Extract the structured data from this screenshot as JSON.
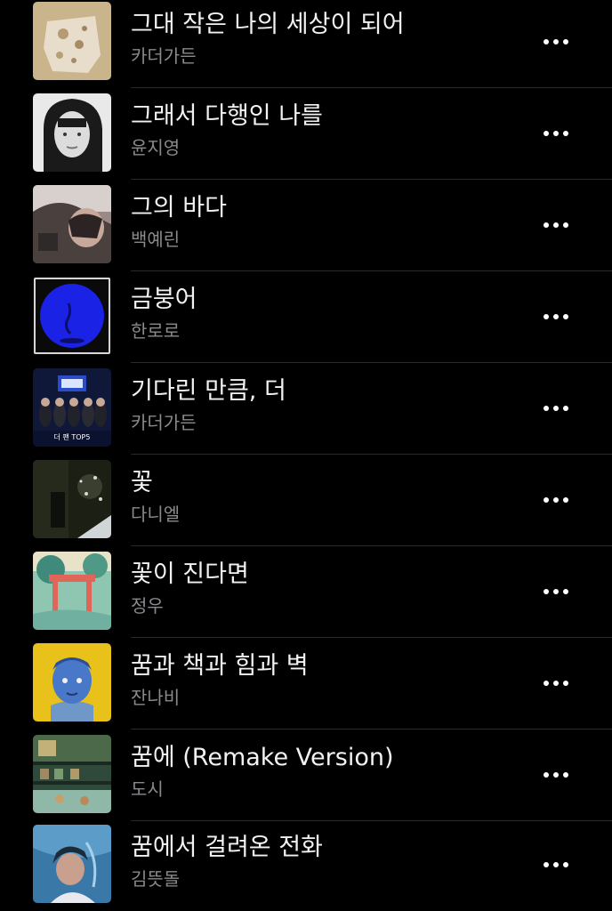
{
  "songs": [
    {
      "title": "그대 작은 나의 세상이 되어",
      "artist": "카더가든"
    },
    {
      "title": "그래서 다행인 나를",
      "artist": "윤지영"
    },
    {
      "title": "그의 바다",
      "artist": "백예린"
    },
    {
      "title": "금붕어",
      "artist": "한로로"
    },
    {
      "title": "기다린 만큼, 더",
      "artist": "카더가든",
      "art_text": "더 팬 TOP5"
    },
    {
      "title": "꽃",
      "artist": "다니엘"
    },
    {
      "title": "꽃이 진다면",
      "artist": "정우"
    },
    {
      "title": "꿈과 책과 힘과 벽",
      "artist": "잔나비"
    },
    {
      "title": "꿈에 (Remake Version)",
      "artist": "도시"
    },
    {
      "title": "꿈에서 걸려온 전화",
      "artist": "김뜻돌"
    }
  ],
  "more_icon": "ellipsis-icon",
  "colors": {
    "background": "#000000",
    "title": "#f2f2f2",
    "artist": "#8a8a8e",
    "divider": "#2a2a2c"
  }
}
